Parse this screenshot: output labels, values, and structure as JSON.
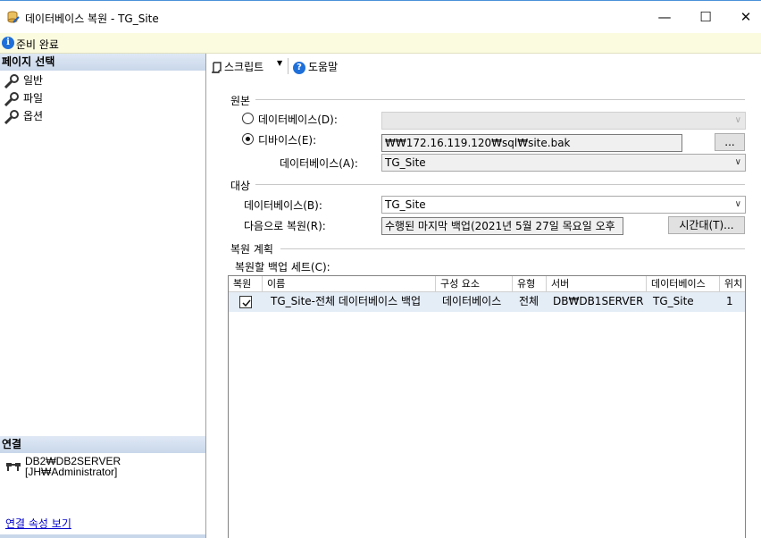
{
  "window": {
    "title": "데이터베이스 복원 - TG_Site",
    "minimize": "—",
    "maximize": "☐",
    "close": "✕"
  },
  "status": {
    "text": "준비 완료"
  },
  "left_panel": {
    "page_select_header": "페이지 선택",
    "pages": [
      {
        "label": "일반",
        "icon": "wrench-icon"
      },
      {
        "label": "파일",
        "icon": "wrench-icon"
      },
      {
        "label": "옵션",
        "icon": "wrench-icon"
      }
    ],
    "connection_header": "연결",
    "connection_server": "DB2₩DB2SERVER",
    "connection_user": "[JH₩Administrator]",
    "connection_link": "연결 속성 보기"
  },
  "toolbar": {
    "script_label": "스크립트",
    "help_label": "도움말"
  },
  "source": {
    "group_label": "원본",
    "database_radio_label": "데이터베이스(D):",
    "device_radio_label": "디바이스(E):",
    "device_path": "₩₩172.16.119.120₩sql₩site.bak",
    "browse_label": "...",
    "database_label": "데이터베이스(A):",
    "database_value": "TG_Site",
    "selected": "device"
  },
  "destination": {
    "group_label": "대상",
    "database_label": "데이터베이스(B):",
    "database_value": "TG_Site",
    "restore_to_label": "다음으로 복원(R):",
    "restore_to_value": "수행된 마지막 백업(2021년 5월 27일 목요일 오후",
    "timeline_button": "시간대(T)..."
  },
  "plan": {
    "group_label": "복원 계획",
    "backup_sets_label": "복원할 백업 세트(C):",
    "columns": [
      "복원",
      "이름",
      "구성 요소",
      "유형",
      "서버",
      "데이터베이스",
      "위치"
    ],
    "rows": [
      {
        "restore": true,
        "name": "TG_Site-전체 데이터베이스 백업",
        "component": "데이터베이스",
        "type": "전체",
        "server": "DB₩DB1SERVER",
        "database": "TG_Site",
        "position": "1"
      }
    ]
  }
}
